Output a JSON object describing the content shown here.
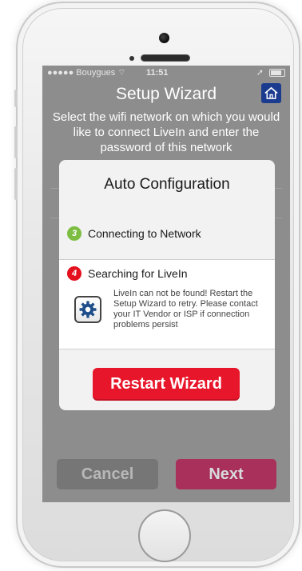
{
  "status_bar": {
    "carrier": "●●●●● Bouygues ⌔",
    "time": "11:51",
    "location_glyph": "➚"
  },
  "header": {
    "title": "Setup Wizard",
    "home_icon": "home-icon"
  },
  "intro_text": "Select the wifi network on which you would like to connect LiveIn and enter the password of this network",
  "modal": {
    "title": "Auto Configuration",
    "steps": [
      {
        "number": "3",
        "label": "Connecting to Network",
        "color": "#7cbd42"
      },
      {
        "number": "4",
        "label": "Searching for LiveIn",
        "color": "#e4101e"
      }
    ],
    "error_icon": "gear-icon",
    "error_message": "LiveIn can not be found! Restart the Setup Wizard to retry. Please contact your IT Vendor or ISP if connection problems persist",
    "restart_label": "Restart Wizard"
  },
  "footer": {
    "cancel_label": "Cancel",
    "next_label": "Next"
  },
  "colors": {
    "accent_red": "#e8162a",
    "next_button": "#a8305a",
    "home_icon_bg": "#1b3b8f"
  }
}
